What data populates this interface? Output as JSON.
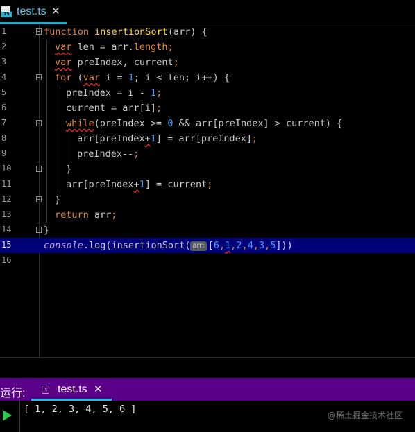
{
  "tab": {
    "icon_label": "TS",
    "icon": "typescript-file-icon",
    "name": "test.ts",
    "close": "✕"
  },
  "editor": {
    "current_line": 15,
    "line_numbers": [
      "1",
      "2",
      "3",
      "4",
      "5",
      "6",
      "7",
      "8",
      "9",
      "10",
      "11",
      "12",
      "13",
      "14",
      "15",
      "16"
    ],
    "tokens": {
      "l1": [
        "function",
        " ",
        "insertionSort",
        "(arr) {"
      ],
      "l2": [
        "var",
        " len = arr.",
        "length",
        ";"
      ],
      "l3": [
        "var",
        " preIndex, current",
        ";"
      ],
      "l4": [
        "for",
        " (",
        "var",
        " i = ",
        "1",
        "; i < len; i++) {"
      ],
      "l5": [
        "preIndex = i - ",
        "1",
        ";"
      ],
      "l6": [
        "current = arr[i]",
        ";"
      ],
      "l7": [
        "while",
        "(preIndex >= ",
        "0",
        " && arr[preIndex] > current) {"
      ],
      "l8": [
        "arr[preIndex",
        "+",
        "1",
        "] = arr[preIndex]",
        ";"
      ],
      "l9": [
        "preIndex--",
        ";"
      ],
      "l10": [
        "}"
      ],
      "l11": [
        "arr[preIndex",
        "+",
        "1",
        "] = current",
        ";"
      ],
      "l12": [
        "}"
      ],
      "l13": [
        "return",
        " arr",
        ";"
      ],
      "l14": [
        "}"
      ],
      "l15": [
        "console",
        ".log(insertionSort(",
        "arr:",
        "[",
        "6",
        ",",
        "1",
        ",",
        "2",
        ",",
        "4",
        ",",
        "3",
        ",",
        "5",
        "]))"
      ]
    }
  },
  "run": {
    "label": "运行:",
    "tab_icon": "js",
    "tab_name": "test.ts",
    "close": "✕",
    "output": "[ 1, 2, 3, 4, 5, 6 ]",
    "play_icon": "run-play-icon",
    "watermark": "@稀土掘金技术社区"
  },
  "colors": {
    "accent": "#29a8c9",
    "run_bar": "#5b0088",
    "current_line": "#000078",
    "keyword": "#e0873c",
    "function": "#ffd24a",
    "number": "#3aa0ff"
  }
}
